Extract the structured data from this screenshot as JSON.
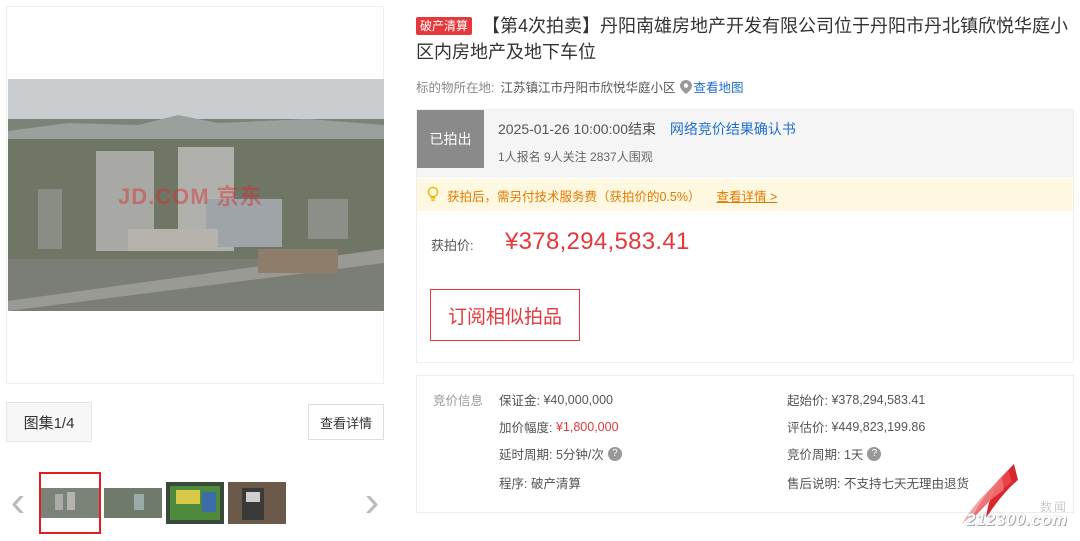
{
  "gallery": {
    "main_watermark": "JD.COM 京东",
    "album_label": "图集1/4",
    "detail_label": "查看详情",
    "prev_arrow": "‹",
    "next_arrow": "›"
  },
  "item": {
    "badge": "破产清算",
    "title": "【第4次拍卖】丹阳南雄房地产开发有限公司位于丹阳市丹北镇欣悦华庭小区内房地产及地下车位",
    "location_label": "标的物所在地:",
    "location_value": "江苏镇江市丹阳市欣悦华庭小区",
    "map_link": "查看地图"
  },
  "status": {
    "sold_tag": "已拍出",
    "end_time": "2025-01-26 10:00:00结束",
    "confirm_link": "网络竞价结果确认书",
    "counts": "1人报名  9人关注  2837人围观",
    "notice_text": "获拍后，需另付技术服务费（获拍价的0.5%）",
    "notice_more": "查看详情 >",
    "price_label": "获拍价:",
    "price_value": "¥378,294,583.41",
    "subscribe_label": "订阅相似拍品"
  },
  "bid_info": {
    "heading": "竞价信息",
    "deposit_label": "保证金:",
    "deposit_value": "¥40,000,000",
    "increment_label": "加价幅度:",
    "increment_value": "¥1,800,000",
    "delay_label": "延时周期:",
    "delay_value": "5分钟/次",
    "procedure_label": "程序:",
    "procedure_value": "破产清算",
    "start_label": "起始价:",
    "start_value": "¥378,294,583.41",
    "appraise_label": "评估价:",
    "appraise_value": "¥449,823,199.86",
    "cycle_label": "竞价周期:",
    "cycle_value": "1天",
    "aftersale_label": "售后说明:",
    "aftersale_value": "不支持七天无理由退货"
  },
  "corner_logo": {
    "domain": "212300.com",
    "cn": "数闻"
  },
  "colors": {
    "accent_red": "#e4393c",
    "link_blue": "#1f6fd1",
    "notice_bg": "#fff8e1",
    "sold_gray": "#8a8a8a"
  }
}
